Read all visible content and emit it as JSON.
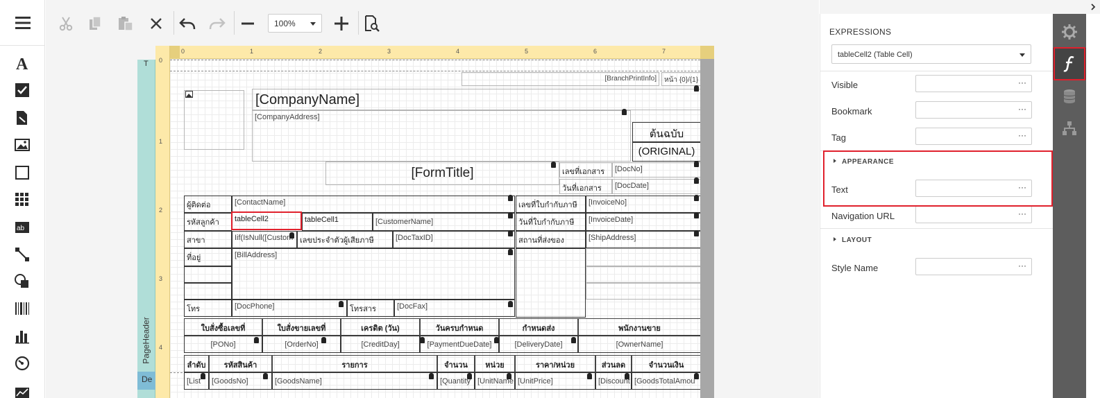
{
  "toolbar": {
    "zoom": "100%"
  },
  "band": {
    "page_header_label": "PageHeader",
    "top_label": "T",
    "detail_label": "De"
  },
  "ruler": {
    "h_numbers": [
      "0",
      "1",
      "2",
      "3",
      "4",
      "5",
      "6",
      "7"
    ],
    "v_numbers": [
      "0",
      "1",
      "2",
      "3",
      "4"
    ]
  },
  "report": {
    "branch_print": "[BranchPrintInfo]",
    "page_info": "หน้า {0}/{1}",
    "company_name": "[CompanyName]",
    "company_address": "[CompanyAddress]",
    "original_th": "ต้นฉบับ",
    "original_en": "(ORIGINAL)",
    "form_title": "[FormTitle]",
    "doc_no_label": "เลขที่เอกสาร",
    "doc_no": "[DocNo]",
    "doc_date_label": "วันที่เอกสาร",
    "doc_date": "[DocDate]",
    "contact_label": "ผู้ติดต่อ",
    "contact_name": "[ContactName]",
    "invoice_no_label": "เลขที่ใบกำกับภาษี",
    "invoice_no": "[InvoiceNo]",
    "customer_code_label": "รหัสลูกค้า",
    "table_cell2": "tableCell2",
    "table_cell1": "tableCell1",
    "customer_name": "[CustomerName]",
    "invoice_date_label": "วันที่ใบกำกับภาษี",
    "invoice_date": "[InvoiceDate]",
    "branch_label": "สาขา",
    "branch_expr": "Iif(IsNull([Custom",
    "tax_id_label": "เลขประจำตัวผู้เสียภาษี",
    "doc_tax_id": "[DocTaxID]",
    "ship_label": "สถานที่ส่งของ",
    "ship_address": "[ShipAddress]",
    "address_label": "ที่อยู่",
    "bill_address": "[BillAddress]",
    "phone_label": "โทร",
    "doc_phone": "[DocPhone]",
    "fax_label": "โทรสาร",
    "doc_fax": "[DocFax]",
    "info_headers": [
      "ใบสั่งซื้อเลขที่",
      "ใบสั่งขายเลขที่",
      "เครดิต (วัน)",
      "วันครบกำหนด",
      "กำหนดส่ง",
      "พนักงานขาย"
    ],
    "info_values": [
      "[PONo]",
      "[OrderNo]",
      "[CreditDay]",
      "[PaymentDueDate]",
      "[DeliveryDate]",
      "[OwnerName]"
    ],
    "item_headers": [
      "ลำดับ",
      "รหัสสินค้า",
      "รายการ",
      "จำนวน",
      "หน่วย",
      "ราคา/หน่วย",
      "ส่วนลด",
      "จำนวนเงิน"
    ],
    "item_values": [
      "[List",
      "[GoodsNo]",
      "[GoodsName]",
      "[Quantity",
      "[UnitName",
      "[UnitPrice]",
      "[Discount",
      "[GoodsTotalAmou"
    ]
  },
  "props": {
    "title": "EXPRESSIONS",
    "selected": "tableCell2 (Table Cell)",
    "visible_label": "Visible",
    "bookmark_label": "Bookmark",
    "tag_label": "Tag",
    "appearance_group": "APPEARANCE",
    "text_label": "Text",
    "navigation_label": "Navigation URL",
    "layout_group": "LAYOUT",
    "style_label": "Style Name",
    "ellipsis": "···"
  }
}
